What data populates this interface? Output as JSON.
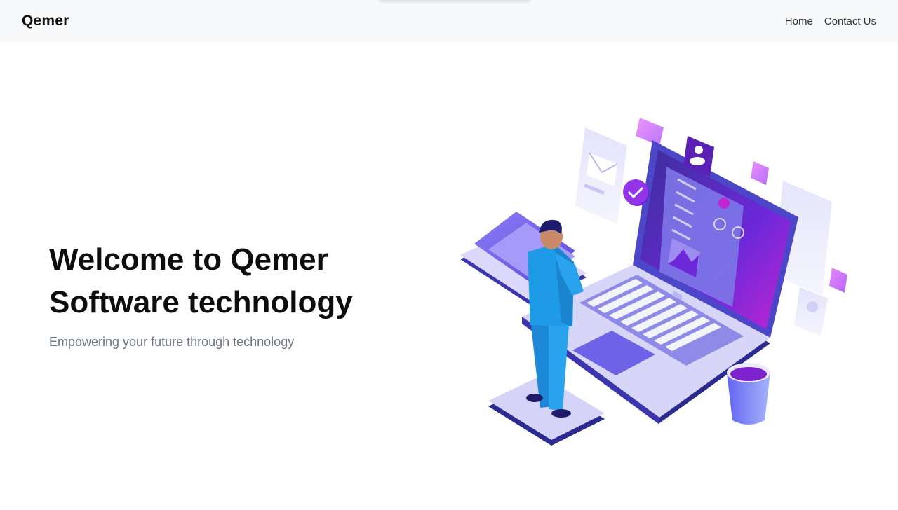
{
  "navbar": {
    "brand": "Qemer",
    "links": [
      "Home",
      "Contact Us"
    ]
  },
  "hero": {
    "title_line1": "Welcome to Qemer",
    "title_line2": "Software technology",
    "subtitle": "Empowering your future through technology"
  },
  "colors": {
    "navbar_bg": "#f8f9fa",
    "accent_purple": "#6c5ce7",
    "accent_magenta": "#c026d3",
    "person_blue": "#1e9be6"
  },
  "icons": {
    "illustration": "isometric-laptop-illustration"
  }
}
